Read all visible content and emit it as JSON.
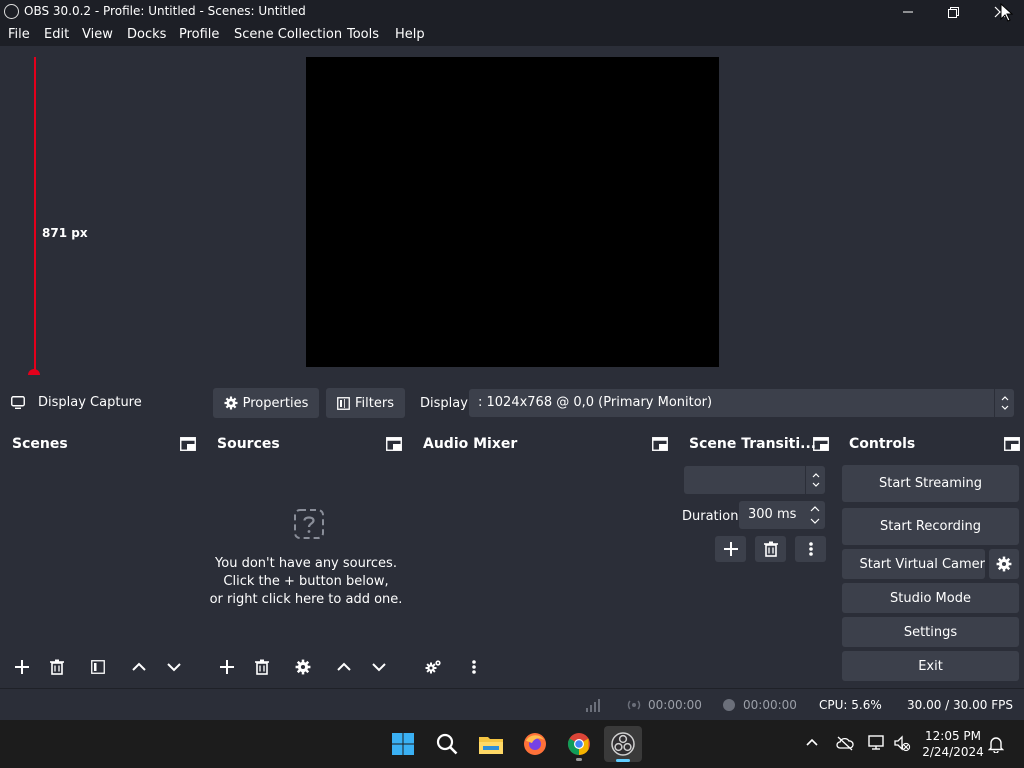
{
  "window": {
    "title": "OBS 30.0.2 - Profile: Untitled - Scenes: Untitled"
  },
  "menu": [
    "File",
    "Edit",
    "View",
    "Docks",
    "Profile",
    "Scene Collection",
    "Tools",
    "Help"
  ],
  "preview": {
    "measure_label": "871 px"
  },
  "source_toolbar": {
    "source_name": "Display Capture",
    "properties_label": "Properties",
    "filters_label": "Filters",
    "display_label": "Display",
    "display_value": ": 1024x768 @ 0,0 (Primary Monitor)"
  },
  "docks": {
    "scenes": {
      "title": "Scenes"
    },
    "sources": {
      "title": "Sources",
      "empty_line1": "You don't have any sources.",
      "empty_line2": "Click the + button below,",
      "empty_line3": "or right click here to add one."
    },
    "audio_mixer": {
      "title": "Audio Mixer"
    },
    "transitions": {
      "title": "Scene Transiti...",
      "duration_label": "Duration",
      "duration_value": "300 ms"
    },
    "controls": {
      "title": "Controls",
      "start_streaming": "Start Streaming",
      "start_recording": "Start Recording",
      "start_virtual_camera": "Start Virtual Camera",
      "studio_mode": "Studio Mode",
      "settings": "Settings",
      "exit": "Exit"
    }
  },
  "status": {
    "stream_time": "00:00:00",
    "record_time": "00:00:00",
    "cpu": "CPU: 5.6%",
    "fps": "30.00 / 30.00 FPS"
  },
  "taskbar": {
    "time": "12:05 PM",
    "date": "2/24/2024"
  },
  "colors": {
    "panel_bg": "#2b2e38",
    "dock_body_bg": "#1f2128",
    "button_bg": "#3c404b",
    "measure_red": "#e4001b"
  }
}
